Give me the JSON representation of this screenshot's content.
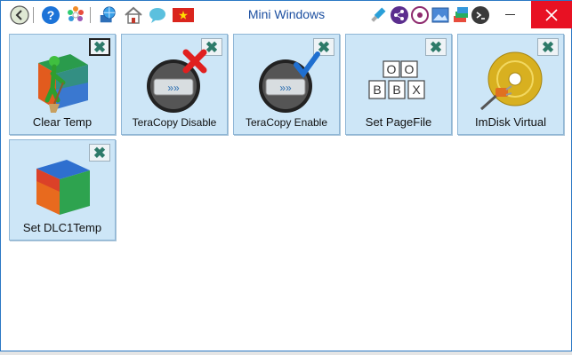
{
  "window": {
    "title": "Mini Windows"
  },
  "toolbar": {
    "left_icons": [
      "back-icon",
      "help-icon",
      "settings-flower-icon",
      "network-globe-icon",
      "home-icon",
      "chat-bubble-icon",
      "vietnam-flag-icon"
    ],
    "right_icons": [
      "usb-icon",
      "share-icon",
      "disc-icon",
      "image-icon",
      "layers-icon",
      "terminal-icon"
    ]
  },
  "tiles": [
    {
      "label": "Clear Temp",
      "icon": "cleaner-cube-icon"
    },
    {
      "label": "TeraCopy Disable",
      "icon": "teracopy-disable-icon"
    },
    {
      "label": "TeraCopy Enable",
      "icon": "teracopy-enable-icon"
    },
    {
      "label": "Set PageFile",
      "icon": "blocks-icon"
    },
    {
      "label": "ImDisk Virtual",
      "icon": "virtual-disk-icon"
    },
    {
      "label": "Set DLC1Temp",
      "icon": "color-cube-icon"
    }
  ],
  "colors": {
    "tile_bg": "#cde6f7",
    "title_color": "#1c4fa0",
    "close_bg": "#e81123",
    "close_x": "#2d7a69"
  }
}
